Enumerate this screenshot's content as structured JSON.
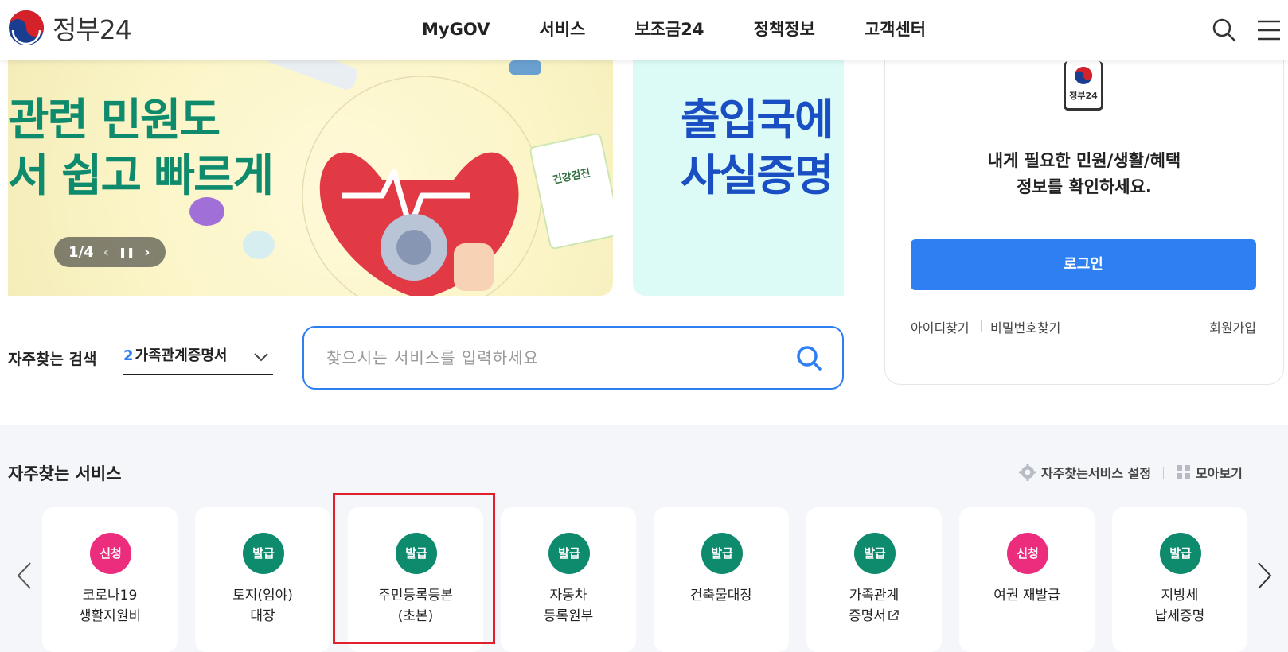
{
  "header": {
    "logo_text": "정부24",
    "nav": [
      "MyGOV",
      "서비스",
      "보조금24",
      "정책정보",
      "고객센터"
    ],
    "icons": [
      "search-icon",
      "menu-icon"
    ]
  },
  "banners": {
    "first": {
      "lines": [
        "관련 민원도",
        "서 쉽고 빠르게"
      ],
      "pager": "1/4",
      "color": "#0e8a6d"
    },
    "second": {
      "lines": [
        "출입국에",
        "사실증명"
      ],
      "color": "#1a4fc4"
    }
  },
  "login": {
    "phone_label": "정부24",
    "message_line1": "내게 필요한 민원/생활/혜택",
    "message_line2": "정보를 확인하세요.",
    "button": "로그인",
    "find_id": "아이디찾기",
    "find_password": "비밀번호찾기",
    "signup": "회원가입",
    "accent": "#2e7ff1"
  },
  "search": {
    "frequent_label": "자주찾는 검색",
    "keyword_rank": "2",
    "keyword": "가족관계증명서",
    "placeholder": "찾으시는 서비스를 입력하세요",
    "value": ""
  },
  "services": {
    "title": "자주찾는 서비스",
    "settings_link": "자주찾는서비스 설정",
    "view_all_link": "모아보기",
    "cards": [
      {
        "badge": "신청",
        "type": "apply",
        "line1": "코로나19",
        "line2": "생활지원비"
      },
      {
        "badge": "발급",
        "type": "issue",
        "line1": "토지(임야)",
        "line2": "대장"
      },
      {
        "badge": "발급",
        "type": "issue",
        "line1": "주민등록등본",
        "line2": "(초본)"
      },
      {
        "badge": "발급",
        "type": "issue",
        "line1": "자동차",
        "line2": "등록원부"
      },
      {
        "badge": "발급",
        "type": "issue",
        "line1": "건축물대장",
        "line2": ""
      },
      {
        "badge": "발급",
        "type": "issue",
        "line1": "가족관계",
        "line2": "증명서"
      },
      {
        "badge": "신청",
        "type": "apply",
        "line1": "여권 재발급",
        "line2": ""
      },
      {
        "badge": "발급",
        "type": "issue",
        "line1": "지방세",
        "line2": "납세증명"
      }
    ],
    "colors": {
      "issue": "#0e8a6d",
      "apply": "#ec2c7c",
      "highlight": "#e0212b"
    }
  }
}
